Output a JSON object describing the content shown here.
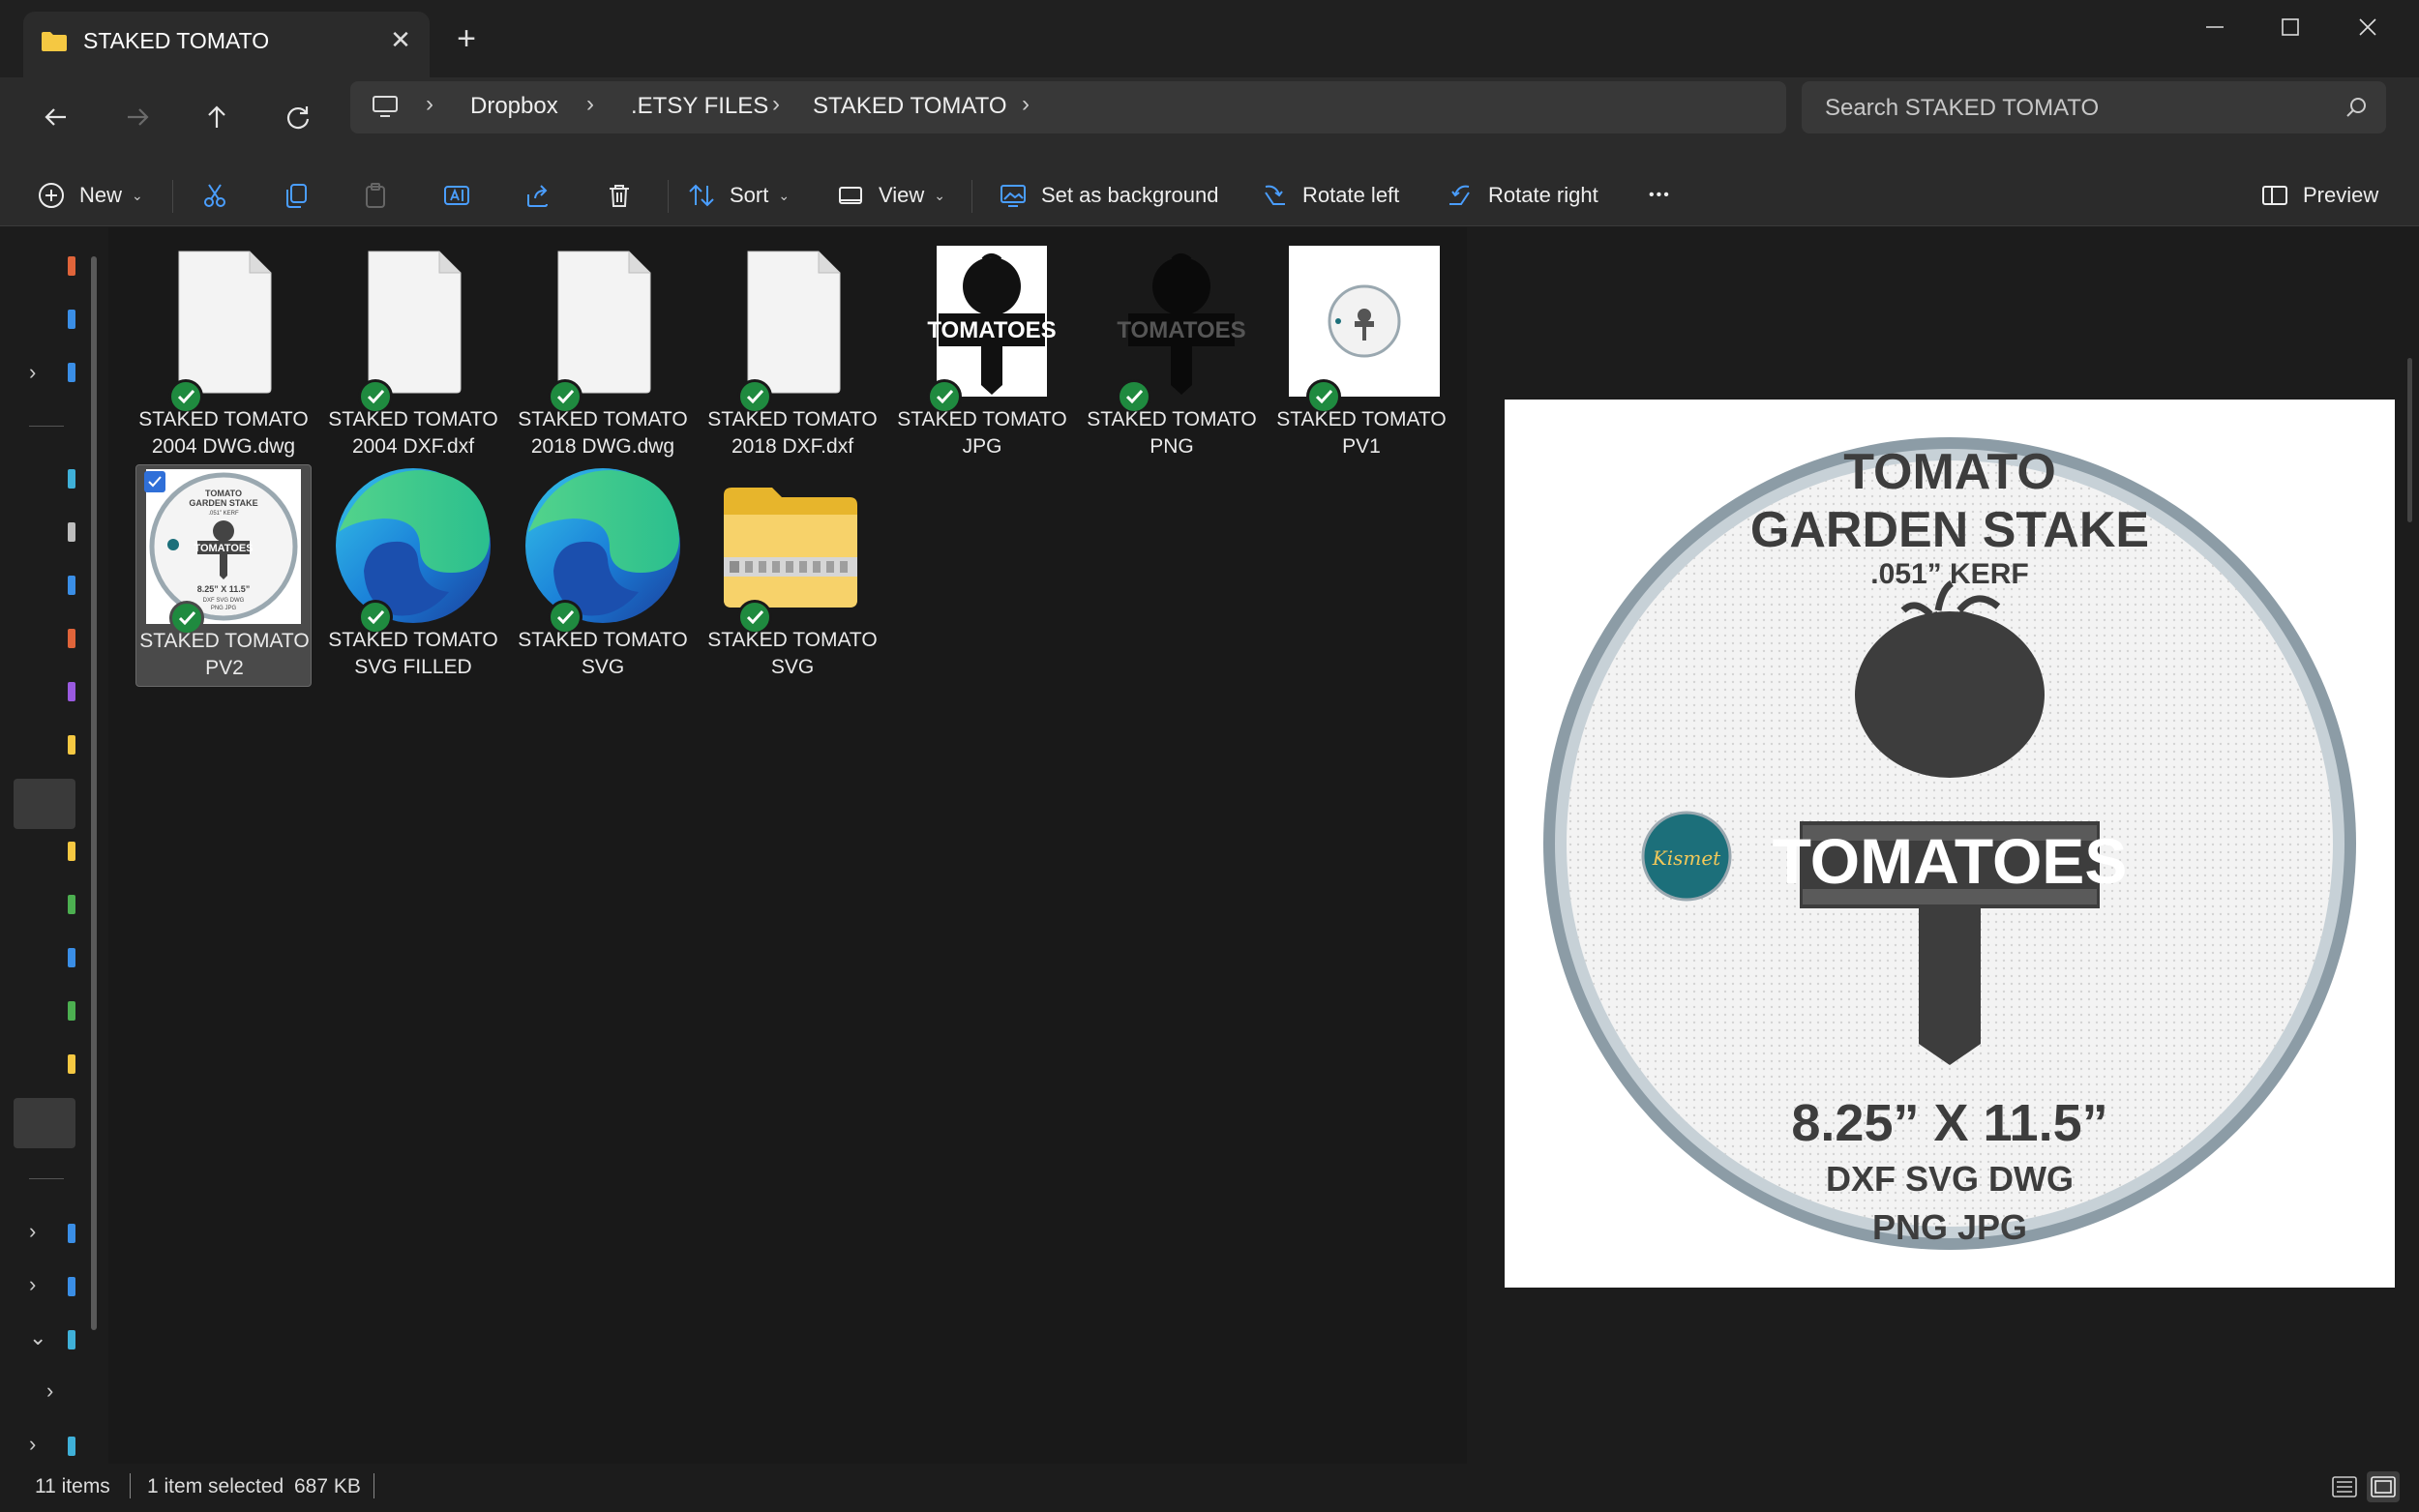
{
  "window": {
    "tab_title": "STAKED TOMATO",
    "new_tab": "+",
    "close_tab": "✕"
  },
  "address": {
    "crumbs": [
      "Dropbox",
      ".ETSY FILES",
      "STAKED TOMATO"
    ]
  },
  "search": {
    "placeholder": "Search STAKED TOMATO"
  },
  "commands": {
    "new": "New",
    "sort": "Sort",
    "view": "View",
    "set_background": "Set as background",
    "rotate_left": "Rotate left",
    "rotate_right": "Rotate right",
    "more": "•••",
    "preview": "Preview"
  },
  "files": [
    {
      "name": "STAKED TOMATO\n2004 DWG.dwg",
      "line1": "STAKED TOMATO",
      "line2": "2004 DWG.dwg",
      "kind": "document",
      "synced": true
    },
    {
      "name": "STAKED TOMATO\n2004 DXF.dxf",
      "line1": "STAKED TOMATO",
      "line2": "2004 DXF.dxf",
      "kind": "document",
      "synced": true
    },
    {
      "name": "STAKED TOMATO\n2018 DWG.dwg",
      "line1": "STAKED TOMATO",
      "line2": "2018 DWG.dwg",
      "kind": "document",
      "synced": true
    },
    {
      "name": "STAKED TOMATO\n2018 DXF.dxf",
      "line1": "STAKED TOMATO",
      "line2": "2018 DXF.dxf",
      "kind": "document",
      "synced": true
    },
    {
      "name": "STAKED TOMATO\nJPG",
      "line1": "STAKED TOMATO",
      "line2": "JPG",
      "kind": "image-jpg",
      "synced": true
    },
    {
      "name": "STAKED TOMATO\nPNG",
      "line1": "STAKED TOMATO",
      "line2": "PNG",
      "kind": "image-png",
      "synced": true
    },
    {
      "name": "STAKED TOMATO\nPV1",
      "line1": "STAKED TOMATO",
      "line2": "PV1",
      "kind": "image-pv1",
      "synced": true
    },
    {
      "name": "STAKED TOMATO\nPV2",
      "line1": "STAKED TOMATO",
      "line2": "PV2",
      "kind": "image-pv2",
      "synced": true,
      "selected": true
    },
    {
      "name": "STAKED TOMATO\nSVG FILLED",
      "line1": "STAKED TOMATO",
      "line2": "SVG FILLED",
      "kind": "edge-svg",
      "synced": true
    },
    {
      "name": "STAKED TOMATO\nSVG",
      "line1": "STAKED TOMATO",
      "line2": "SVG",
      "kind": "edge-svg",
      "synced": true
    },
    {
      "name": "STAKED TOMATO\nSVG",
      "line1": "STAKED TOMATO",
      "line2": "SVG",
      "kind": "zip-folder",
      "synced": true
    }
  ],
  "preview_image": {
    "title1": "TOMATO",
    "title2": "GARDEN STAKE",
    "kerf": ".051” KERF",
    "sign_text": "TOMATOES",
    "size": "8.25”  X  11.5”",
    "formats1": "DXF SVG DWG",
    "formats2": "PNG JPG",
    "logo_text": "Kismet",
    "thumb_word": "TOMATOES",
    "mini_title1": "TOMATO",
    "mini_title2": "GARDEN STAKE",
    "mini_kerf": ".051” KERF",
    "mini_size": "8.25” X 11.5”",
    "mini_fmt1": "DXF SVG DWG",
    "mini_fmt2": "PNG JPG"
  },
  "status": {
    "count": "11 items",
    "selection": "1 item selected",
    "size": "687 KB"
  },
  "colors": {
    "accent": "#2f6fd8",
    "sync_green": "#1f8a3f",
    "folder_yellow": "#f5c842"
  }
}
